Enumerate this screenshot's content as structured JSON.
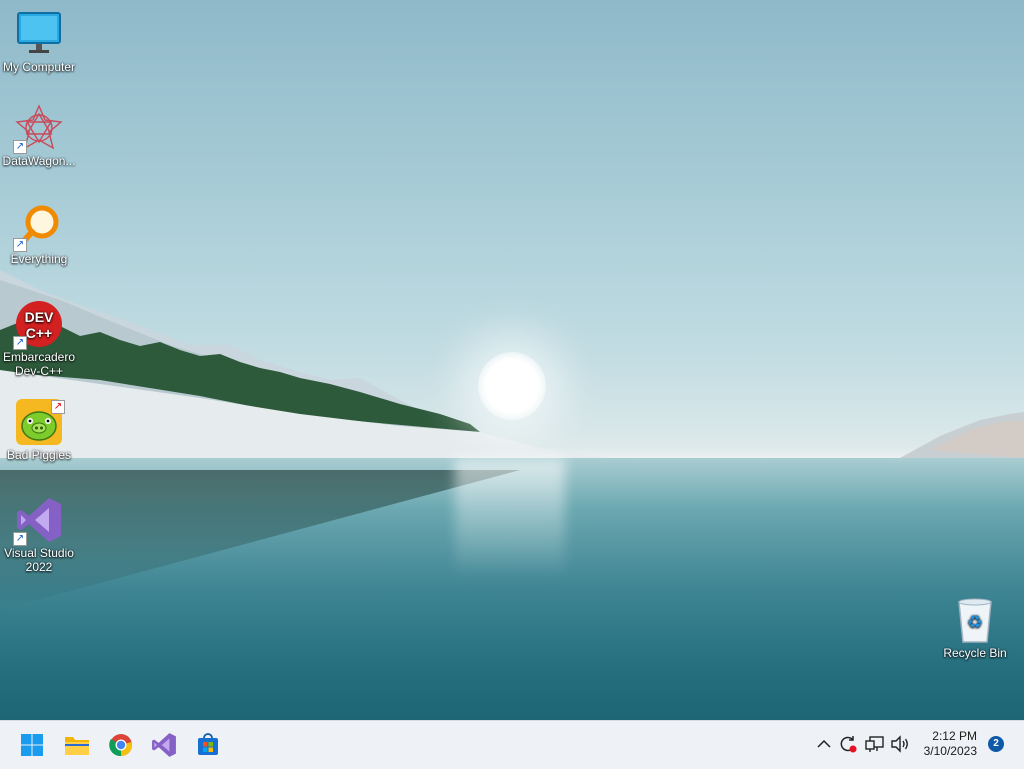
{
  "desktop": {
    "icons": [
      {
        "label": "My Computer",
        "icon": "monitor-icon"
      },
      {
        "label": "DataWagon...",
        "icon": "datawagon-icon"
      },
      {
        "label": "Everything",
        "icon": "magnifier-icon"
      },
      {
        "label": "Embarcadero\nDev-C++",
        "icon": "devcpp-icon",
        "badge_text": "DEV C++"
      },
      {
        "label": "Bad Piggies",
        "icon": "pig-icon"
      },
      {
        "label": "Visual Studio\n2022",
        "icon": "visual-studio-icon"
      },
      {
        "label": "Recycle Bin",
        "icon": "recycle-bin-icon"
      }
    ]
  },
  "taskbar": {
    "apps": [
      {
        "name": "Start",
        "icon": "windows-start-icon"
      },
      {
        "name": "File Explorer",
        "icon": "folder-icon"
      },
      {
        "name": "Google Chrome",
        "icon": "chrome-icon"
      },
      {
        "name": "Visual Studio",
        "icon": "visual-studio-icon"
      },
      {
        "name": "Microsoft Store",
        "icon": "store-icon"
      }
    ],
    "tray": {
      "icons": [
        "chevron-up-icon",
        "sync-icon",
        "network-icon",
        "speaker-icon"
      ],
      "time": "2:12 PM",
      "date": "3/10/2023",
      "notification_count": "2"
    }
  },
  "colors": {
    "taskbar_bg": "#eef1f5",
    "accent": "#0f5aa8",
    "devcpp_red": "#d32020",
    "vs_purple": "#7b4fd6"
  }
}
